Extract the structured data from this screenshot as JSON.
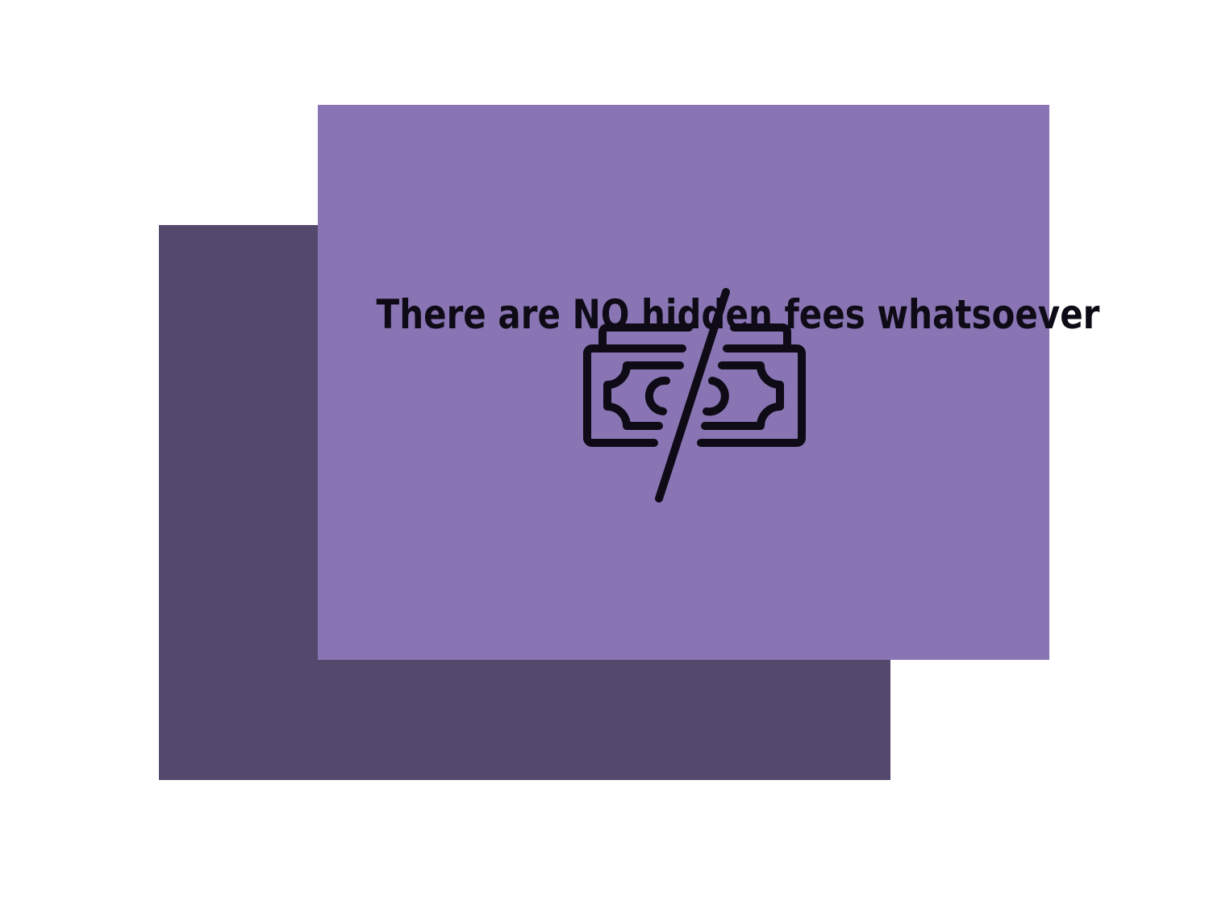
{
  "card": {
    "headline": "There are NO hidden fees whatsoever",
    "icon": "no-hidden-fees-money-slash-icon"
  },
  "colors": {
    "front_panel": "#8975b4",
    "back_panel": "#54496d",
    "text": "#0e0b16",
    "background": "#ffffff"
  }
}
